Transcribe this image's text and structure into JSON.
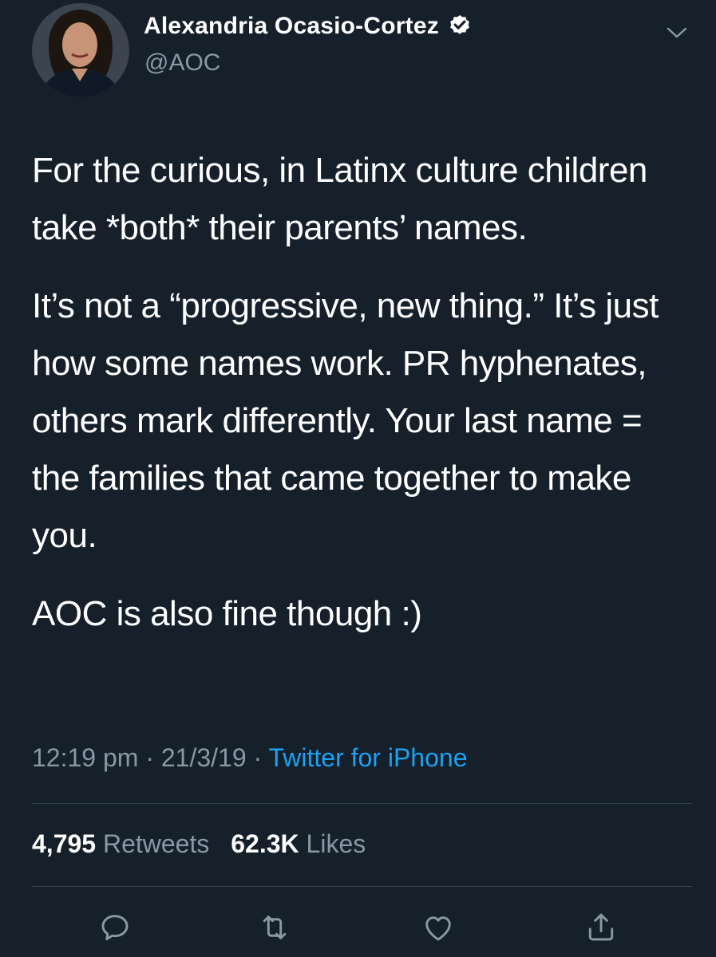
{
  "author": {
    "display_name": "Alexandria Ocasio-Cortez",
    "handle": "@AOC",
    "verified": true
  },
  "tweet": {
    "paragraphs": [
      "For the curious, in Latinx culture children take *both* their parents’ names.",
      "It’s not a “progressive, new thing.” It’s just how some names work. PR hyphenates, others mark differently. Your last name = the families that came together to make you.",
      "AOC is also fine though :)"
    ],
    "time": "12:19 pm",
    "separator": "·",
    "date": "21/3/19",
    "source": "Twitter for iPhone"
  },
  "stats": {
    "retweets_count": "4,795",
    "retweets_label": "Retweets",
    "likes_count": "62.3K",
    "likes_label": "Likes"
  },
  "actions": [
    "reply-icon",
    "retweet-icon",
    "like-icon",
    "share-icon"
  ],
  "colors": {
    "background": "#15202b",
    "text": "#ffffff",
    "secondary": "#8899a6",
    "accent": "#1da1f2",
    "divider": "#38444d"
  }
}
